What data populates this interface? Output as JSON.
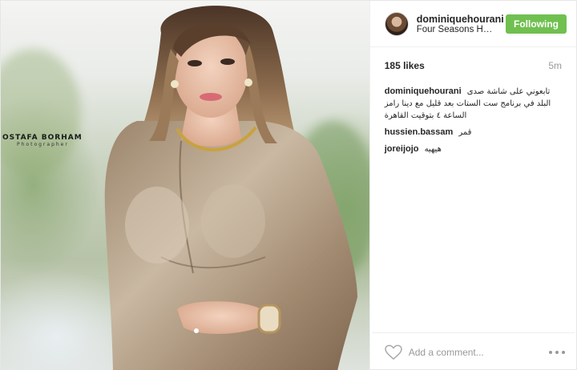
{
  "photo": {
    "watermark_title": "OSTAFA BORHAM",
    "watermark_sub": "Photographer"
  },
  "header": {
    "username": "dominiquehourani",
    "location": "Four Seasons Ho...",
    "follow_label": "Following",
    "follow_color": "#70c050"
  },
  "stats": {
    "likes": "185 likes",
    "time": "5m"
  },
  "comments": [
    {
      "user": "dominiquehourani",
      "text": "تابعوني على شاشة صدى البلد في برنامج ست الستات بعد قليل مع دينا رامز الساعة ٤ بتوقيت القاهرة"
    },
    {
      "user": "hussien.bassam",
      "text": "قمر"
    },
    {
      "user": "joreijojo",
      "text": "هيهيه"
    }
  ],
  "footer": {
    "comment_placeholder": "Add a comment...",
    "like_icon": "heart-icon",
    "more_icon": "more-options-icon"
  }
}
